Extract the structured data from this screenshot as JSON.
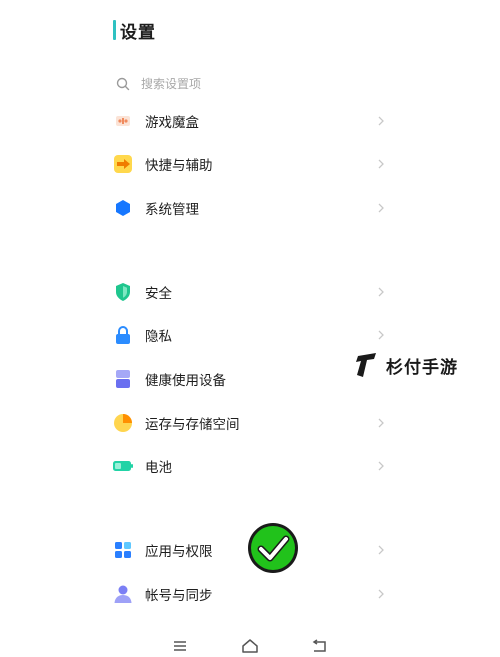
{
  "header": {
    "title": "设置"
  },
  "search": {
    "placeholder": "搜索设置项"
  },
  "settings": {
    "game_box": "游戏魔盒",
    "shortcuts": "快捷与辅助",
    "system": "系统管理",
    "security": "安全",
    "privacy": "隐私",
    "health": "健康使用设备",
    "memory": "运存与存储空间",
    "battery": "电池",
    "apps": "应用与权限",
    "account": "帐号与同步"
  },
  "watermark": {
    "text": "杉付手游"
  },
  "colors": {
    "accent": "#2ec1c1",
    "game_box": "#f08a5d",
    "shortcuts": "#f5b800",
    "system": "#1677ff",
    "security": "#1fc68e",
    "privacy": "#2b8cff",
    "health": "#6a6ff0",
    "memory": "#ffb300",
    "battery": "#22d3a6",
    "apps": "#2a7fff",
    "account": "#7b7ff5",
    "check": "#21c21b"
  }
}
